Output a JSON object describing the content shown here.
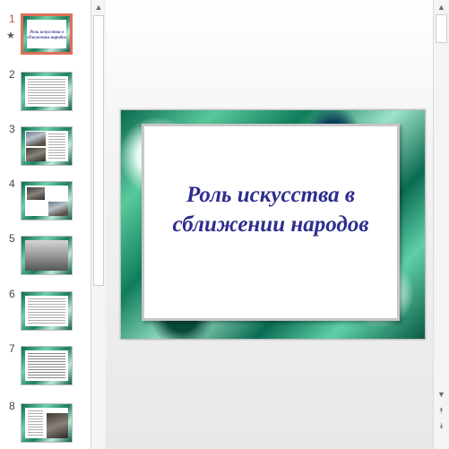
{
  "thumbnails": [
    {
      "number": "1",
      "title": "Роль искусства в сближении народов",
      "selected": true,
      "has_animation_star": true
    },
    {
      "number": "2"
    },
    {
      "number": "3"
    },
    {
      "number": "4"
    },
    {
      "number": "5"
    },
    {
      "number": "6"
    },
    {
      "number": "7"
    },
    {
      "number": "8"
    }
  ],
  "slide": {
    "title_line1": "Роль искусства в",
    "title_line2": "сближении народов"
  },
  "icons": {
    "star": "★",
    "scroll_up": "▲",
    "scroll_down": "▼",
    "prev_slide": "⯭",
    "next_slide": "⯯"
  },
  "colors": {
    "selected_border": "#e07058",
    "title_color": "#2e2e8e"
  }
}
